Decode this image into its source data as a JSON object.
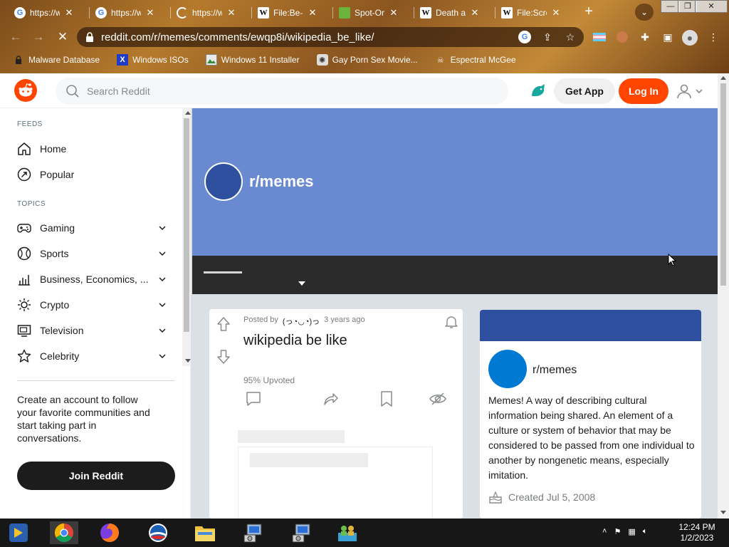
{
  "browser": {
    "tabs": [
      {
        "label": "https://w",
        "icon": "google-icon"
      },
      {
        "label": "https://w",
        "icon": "google-icon"
      },
      {
        "label": "https://w",
        "icon": "loading-spinner-icon"
      },
      {
        "label": "File:Be-li",
        "icon": "wikipedia-icon"
      },
      {
        "label": "Spot-On",
        "icon": "spot-on-icon"
      },
      {
        "label": "Death an",
        "icon": "wikipedia-icon"
      },
      {
        "label": "File:Scre",
        "icon": "wikipedia-icon"
      }
    ],
    "url": "reddit.com/r/memes/comments/ewqp8i/wikipedia_be_like/",
    "bookmarks": [
      {
        "label": "Malware Database",
        "icon": "lock-icon"
      },
      {
        "label": "Windows ISOs",
        "icon": "x-icon"
      },
      {
        "label": "Windows 11 Installer",
        "icon": "image-icon"
      },
      {
        "label": "Gay Porn Sex Movie...",
        "icon": "tumbleweed-icon"
      },
      {
        "label": "Espectral McGee",
        "icon": "skull-icon"
      }
    ]
  },
  "header": {
    "search_placeholder": "Search Reddit",
    "get_app": "Get App",
    "log_in": "Log In"
  },
  "nav": {
    "feeds_heading": "FEEDS",
    "feeds": [
      {
        "label": "Home",
        "icon": "home-icon"
      },
      {
        "label": "Popular",
        "icon": "popular-icon"
      }
    ],
    "topics_heading": "TOPICS",
    "topics": [
      {
        "label": "Gaming",
        "icon": "gamepad-icon"
      },
      {
        "label": "Sports",
        "icon": "ball-icon"
      },
      {
        "label": "Business, Economics, ...",
        "icon": "chart-icon"
      },
      {
        "label": "Crypto",
        "icon": "crypto-icon"
      },
      {
        "label": "Television",
        "icon": "tv-icon"
      },
      {
        "label": "Celebrity",
        "icon": "star-icon"
      }
    ],
    "promo": "Create an account to follow your favorite communities and start taking part in conversations.",
    "join": "Join Reddit"
  },
  "subreddit": {
    "name": "r/memes"
  },
  "post": {
    "posted_by_label": "Posted by",
    "author": "(っ◔◡◔)っ",
    "age": "3 years ago",
    "title": "wikipedia be like",
    "upvoted": "95% Upvoted"
  },
  "sidebar": {
    "name": "r/memes",
    "description": "Memes! A way of describing cultural information being shared. An element of a culture or system of behavior that may be considered to be passed from one individual to another by nongenetic means, especially imitation.",
    "created": "Created Jul 5, 2008"
  },
  "taskbar": {
    "time": "12:24 PM",
    "date": "1/2/2023"
  },
  "colors": {
    "reddit_orange": "#ff4500",
    "banner": "#6989d0",
    "community_blue": "#0079d3"
  }
}
